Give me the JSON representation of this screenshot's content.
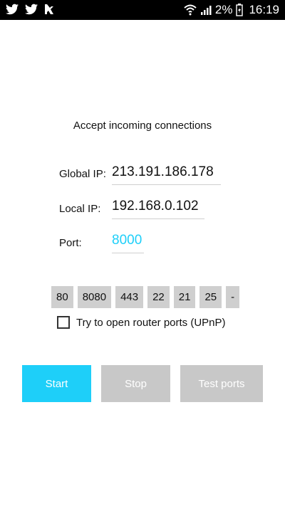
{
  "status_bar": {
    "icons_left": [
      "twitter-icon",
      "twitter-icon",
      "notification-icon"
    ],
    "battery_percent": "2%",
    "time": "16:19"
  },
  "screen": {
    "title": "Accept incoming connections",
    "global_ip": {
      "label": "Global IP:",
      "value": "213.191.186.178"
    },
    "local_ip": {
      "label": "Local IP:",
      "value": "192.168.0.102"
    },
    "port": {
      "label": "Port:",
      "value": "8000"
    },
    "quick_ports": [
      "80",
      "8080",
      "443",
      "22",
      "21",
      "25",
      "-"
    ],
    "upnp_label": "Try to open router ports (UPnP)",
    "upnp_checked": false,
    "buttons": {
      "start": "Start",
      "stop": "Stop",
      "test": "Test ports"
    }
  },
  "colors": {
    "accent": "#1ecff9",
    "disabled": "#c8c8c8",
    "port_text": "#1ecff9"
  }
}
